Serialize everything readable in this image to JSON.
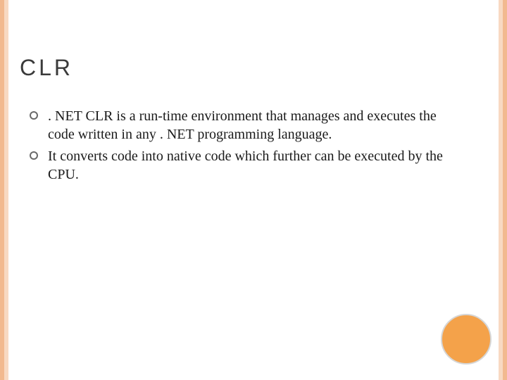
{
  "title": "CLR",
  "bullets": [
    ". NET CLR is a run-time environment that manages and executes the code written in any . NET programming language.",
    "It converts code into native code which further can be executed by the CPU."
  ]
}
